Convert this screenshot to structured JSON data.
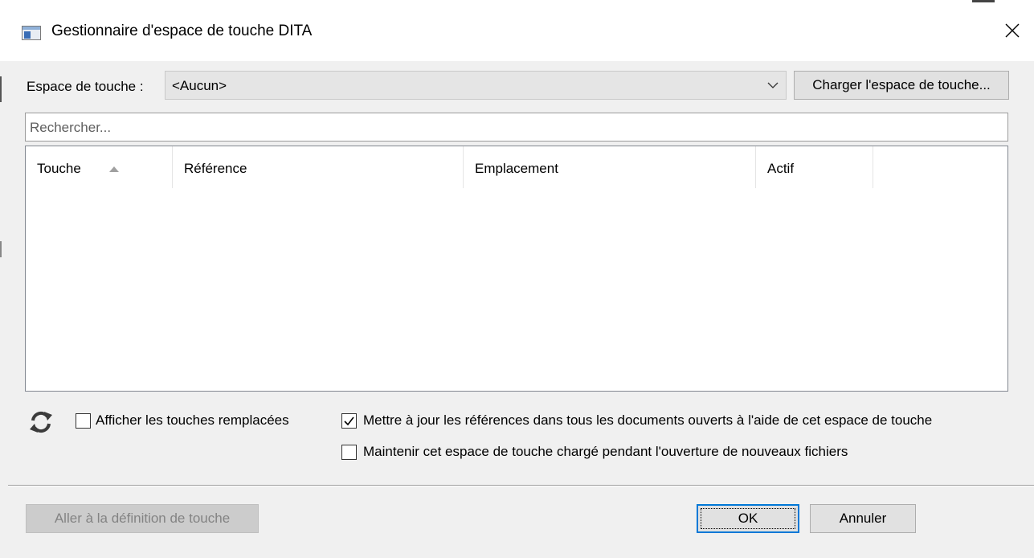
{
  "window": {
    "title": "Gestionnaire d'espace de touche DITA",
    "icon": "window-icon",
    "close_icon": "close-icon"
  },
  "keyspace": {
    "label": "Espace de touche :",
    "selected": "<Aucun>",
    "load_button": "Charger l'espace de touche..."
  },
  "search": {
    "placeholder": "Rechercher..."
  },
  "table": {
    "columns": [
      "Touche",
      "Référence",
      "Emplacement",
      "Actif"
    ],
    "sort_column": "Touche",
    "sort_direction": "ascending",
    "rows": []
  },
  "options": {
    "refresh_icon": "refresh-icon",
    "show_overridden": {
      "label": "Afficher les touches remplacées",
      "checked": false
    },
    "update_references": {
      "label": "Mettre à jour les références dans tous les documents ouverts à l'aide de cet espace de touche",
      "checked": true
    },
    "keep_loaded": {
      "label": "Maintenir cet espace de touche chargé pendant l'ouverture de nouveaux fichiers",
      "checked": false
    }
  },
  "footer": {
    "goto_definition": "Aller à la définition de touche",
    "ok": "OK",
    "cancel": "Annuler"
  }
}
